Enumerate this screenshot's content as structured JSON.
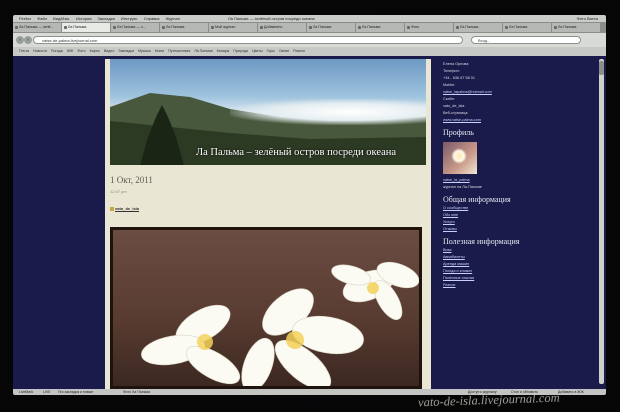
{
  "menubar": {
    "items": [
      "Firefox",
      "Файл",
      "Вид/Изм.",
      "История",
      "Закладки",
      "Инструм.",
      "Справка",
      "Журнал"
    ],
    "window_title": "Ла Пальма — зелёный остров посреди океана",
    "right_text": "Фото Вятеа"
  },
  "tabs": [
    {
      "label": "Ла Пальма — зелё..."
    },
    {
      "label": "Ла Пальма"
    },
    {
      "label": "Ла Пальма — з..."
    },
    {
      "label": "Ла Пальма"
    },
    {
      "label": "Мой журнал"
    },
    {
      "label": "Добавлено"
    },
    {
      "label": "Ла Пальма"
    },
    {
      "label": "Ла Пальма"
    },
    {
      "label": "Фото"
    },
    {
      "label": "Ла Пальма"
    },
    {
      "label": "Ла Пальма"
    },
    {
      "label": "Ла Пальма"
    }
  ],
  "toolbar": {
    "back_label": "‹",
    "forward_label": "›",
    "url": "vatse-de-palma.livejournal.com",
    "search_value": "Вход..."
  },
  "bookmarks": [
    "Почта",
    "Новости",
    "Погода",
    "ЖЖ",
    "Фото",
    "Карты",
    "Видео",
    "Закладки",
    "Музыка",
    "Книги",
    "Путешествия",
    "Ла Пальма",
    "Канары",
    "Природа",
    "Цветы",
    "Горы",
    "Океан",
    "Разное"
  ],
  "post": {
    "banner_title": "Ла Пальма – зелёный остров посреди океана",
    "date": "1 Окт, 2011",
    "time": "12:47 pm",
    "author": "vato_de_isla"
  },
  "sidebar": {
    "contact_lines": [
      "Елена Орлова",
      "Телефон:",
      "+34 - 636 87 58 01",
      "Mobile:",
      "vatse_lapalma@hotmail.com",
      "Скайп:",
      "vato_de_isla",
      "Веб-страница:",
      "www.vatse-palma.com"
    ],
    "profile_heading": "Профиль",
    "profile_user": "vatse_la_palma",
    "profile_sub": "журнал на Ла-Пальме",
    "general_heading": "Общая информация",
    "general_links": [
      "О сообществе",
      "Обо мне",
      "Услуги",
      "Отзывы"
    ],
    "useful_heading": "Полезная информация",
    "useful_links": [
      "Виза",
      "Авиабилеты",
      "Аренда машин",
      "Погода и климат",
      "Полезные ссылки",
      "Разное"
    ]
  },
  "statusbar": {
    "left": "LiveMark",
    "mid1": "LIVE",
    "mid2": "Гео закладок и новые",
    "mid3": "Фото Ла Пальма",
    "right1": "Доступ к журналу",
    "right2": "Стоп и обновить",
    "right3": "Добавить в ЖЖ"
  },
  "watermark": "vato-de-isla.livejournal.com"
}
